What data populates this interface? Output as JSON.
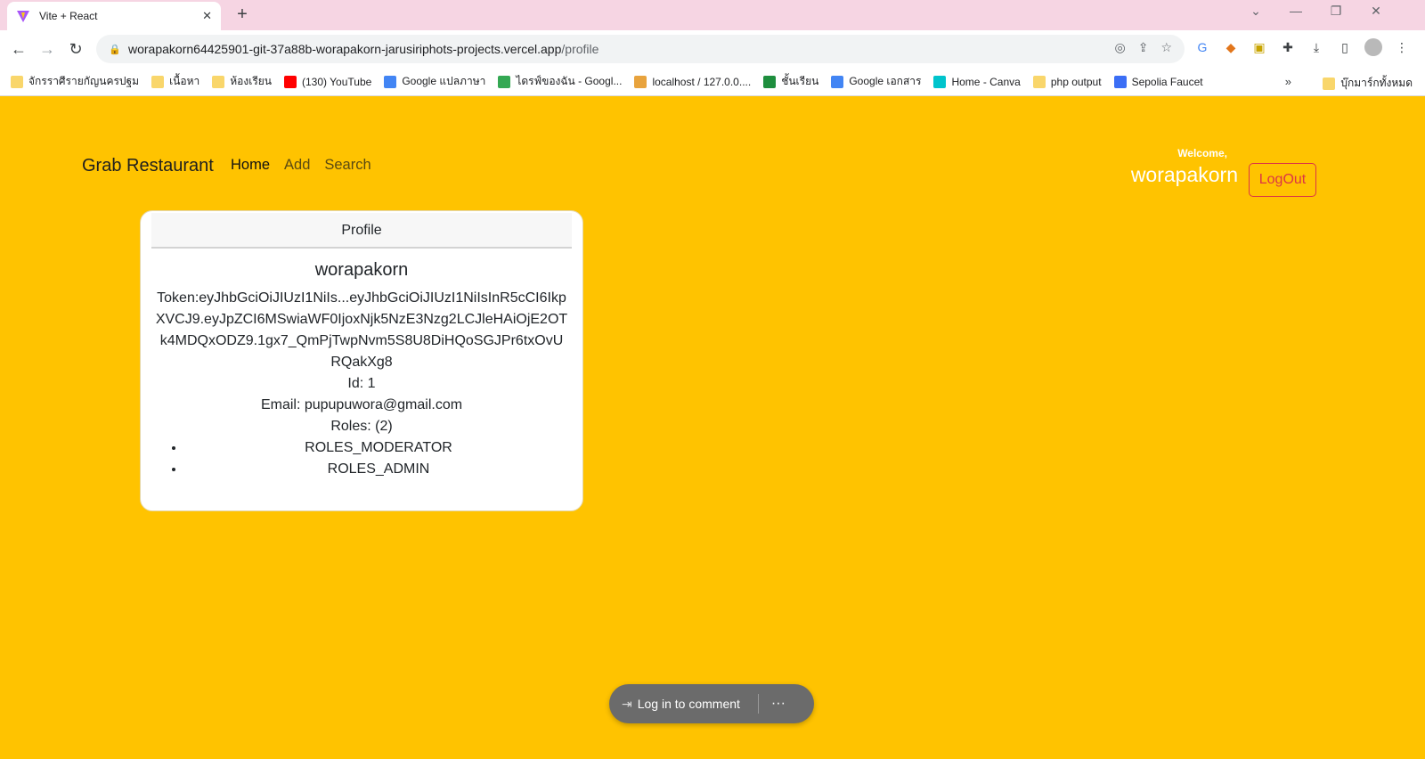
{
  "browser": {
    "tab_title": "Vite + React",
    "url_host": "worapakorn64425901-git-37a88b-worapakorn-jarusiriphots-projects.vercel.app",
    "url_path": "/profile",
    "bookmarks": [
      {
        "label": "จักรราศีรายกัญนครปฐม",
        "icon": "folder-icon",
        "color": "#f9d66b"
      },
      {
        "label": "เนื้อหา",
        "icon": "folder-icon",
        "color": "#f9d66b"
      },
      {
        "label": "ห้องเรียน",
        "icon": "folder-icon",
        "color": "#f9d66b"
      },
      {
        "label": "(130) YouTube",
        "icon": "youtube-icon",
        "color": "#ff0000"
      },
      {
        "label": "Google แปลภาษา",
        "icon": "translate-icon",
        "color": "#4285f4"
      },
      {
        "label": "ไดรฟ์ของฉัน - Googl...",
        "icon": "drive-icon",
        "color": "#34a853"
      },
      {
        "label": "localhost / 127.0.0....",
        "icon": "phpmyadmin-icon",
        "color": "#e8a33d"
      },
      {
        "label": "ชั้นเรียน",
        "icon": "classroom-icon",
        "color": "#1e8e3e"
      },
      {
        "label": "Google เอกสาร",
        "icon": "docs-icon",
        "color": "#4285f4"
      },
      {
        "label": "Home - Canva",
        "icon": "canva-icon",
        "color": "#00c4cc"
      },
      {
        "label": "php output",
        "icon": "folder-icon",
        "color": "#f9d66b"
      },
      {
        "label": "Sepolia Faucet",
        "icon": "alchemy-icon",
        "color": "#3b6ef5"
      }
    ],
    "bookmarks_more": "»",
    "bookmarks_other": "บุ๊กมาร์กทั้งหมด"
  },
  "navbar": {
    "brand": "Grab Restaurant",
    "links": [
      "Home",
      "Add",
      "Search"
    ],
    "welcome_label": "Welcome,",
    "username": "worapakorn",
    "logout_label": "LogOut"
  },
  "profile": {
    "header": "Profile",
    "username": "worapakorn",
    "token": "Token:eyJhbGciOiJIUzI1NiIs...eyJhbGciOiJIUzI1NiIsInR5cCI6IkpXVCJ9.eyJpZCI6MSwiaWF0IjoxNjk5NzE3Nzg2LCJleHAiOjE2OTk4MDQxODZ9.1gx7_QmPjTwpNvm5S8U8DiHQoSGJPr6txOvURQakXg8",
    "id_line": "Id: 1",
    "email_line": "Email: pupupuwora@gmail.com",
    "roles_line": "Roles: (2)",
    "roles": [
      "ROLES_MODERATOR",
      "ROLES_ADMIN"
    ]
  },
  "comment": {
    "label": "Log in to comment",
    "more": "···"
  }
}
